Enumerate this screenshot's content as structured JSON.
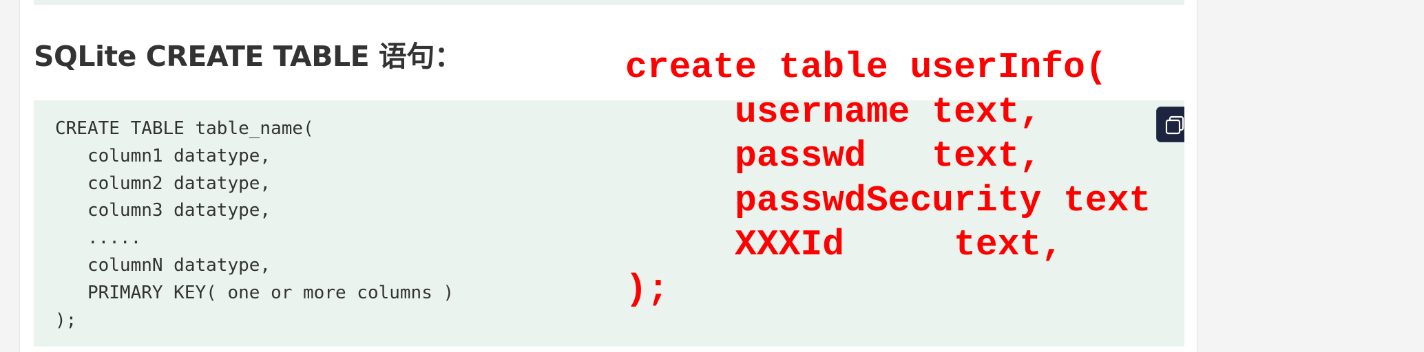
{
  "heading": "SQLite CREATE TABLE 语句：",
  "code_block": {
    "lines": [
      "CREATE TABLE table_name(",
      "   column1 datatype,",
      "   column2 datatype,",
      "   column3 datatype,",
      "   .....",
      "   columnN datatype,",
      "   PRIMARY KEY( one or more columns )",
      ");"
    ],
    "copy_icon": "copy-icon"
  },
  "annotation": {
    "color": "#ff0000",
    "lines": [
      "create table userInfo(",
      "     username text,",
      "     passwd   text,",
      "     passwdSecurity text",
      "     XXXId     text,",
      ");"
    ]
  }
}
